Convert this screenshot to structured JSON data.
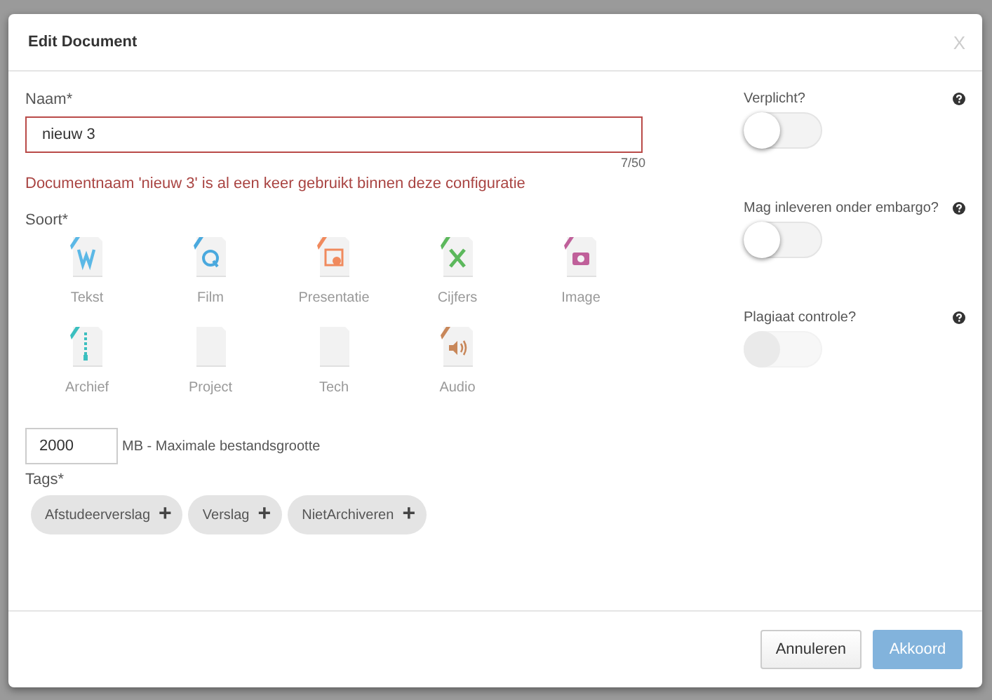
{
  "dialog": {
    "title": "Edit Document",
    "close": "X"
  },
  "name_field": {
    "label": "Naam*",
    "value": "nieuw 3",
    "counter": "7/50",
    "invalid": true,
    "error": "Documentnaam 'nieuw 3' is al een keer gebruikt binnen deze configuratie"
  },
  "type_label": "Soort*",
  "types": [
    {
      "label": "Tekst",
      "kind": "word",
      "color": "#5bb8e6",
      "selected": false
    },
    {
      "label": "Film",
      "kind": "video",
      "color": "#4aa9de",
      "selected": false
    },
    {
      "label": "Presentatie",
      "kind": "slides",
      "color": "#f08a5d",
      "selected": false
    },
    {
      "label": "Cijfers",
      "kind": "sheet",
      "color": "#5cb85c",
      "selected": false
    },
    {
      "label": "Image",
      "kind": "image",
      "color": "#c0609a",
      "selected": false
    },
    {
      "label": "Archief",
      "kind": "archive",
      "color": "#3bbfbf",
      "selected": false
    },
    {
      "label": "Project",
      "kind": "blank",
      "selected": false
    },
    {
      "label": "Tech",
      "kind": "blank",
      "selected": false
    },
    {
      "label": "Audio",
      "kind": "audio",
      "color": "#c8875a",
      "selected": false
    }
  ],
  "size_field": {
    "value": "2000",
    "suffix": "MB - Maximale bestandsgrootte"
  },
  "tags_label": "Tags*",
  "tags": [
    {
      "label": "Afstudeerverslag",
      "action": "+"
    },
    {
      "label": "Verslag",
      "action": "+"
    },
    {
      "label": "NietArchiveren",
      "action": "+"
    }
  ],
  "options": [
    {
      "label": "Verplicht?",
      "on": false,
      "disabled": false
    },
    {
      "label": "Mag inleveren onder embargo?",
      "on": false,
      "disabled": false
    },
    {
      "label": "Plagiaat controle?",
      "on": false,
      "disabled": true
    }
  ],
  "buttons": [
    {
      "label": "Annuleren",
      "kind": "secondary",
      "disabled": false
    },
    {
      "label": "Akkoord",
      "kind": "primary",
      "disabled": true
    }
  ]
}
